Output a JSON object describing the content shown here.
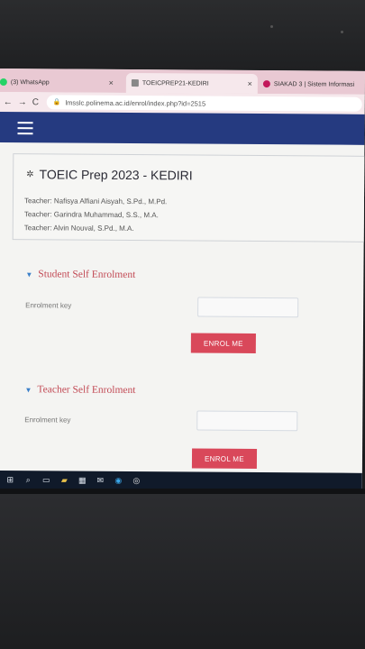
{
  "browser": {
    "tabs": [
      {
        "label": "(3) WhatsApp",
        "close": "×",
        "icon": "whatsapp-icon",
        "color": "#25d366"
      },
      {
        "label": "TOEICPREP21-KEDIRI",
        "close": "×",
        "icon": "moodle-icon",
        "color": "#888888"
      },
      {
        "label": "SIAKAD 3 | Sistem Informasi",
        "close": "",
        "icon": "siakad-icon",
        "color": "#c2185b"
      }
    ],
    "nav_glyphs": "←→C",
    "url": "lmsslc.polinema.ac.id/enrol/index.php?id=2515"
  },
  "navbar": {
    "menu_icon": "hamburger-icon",
    "color": "#253a80"
  },
  "course": {
    "title": "TOEIC Prep 2023 - KEDIRI",
    "teachers": [
      "Teacher: Nafisya Alfiani Aisyah, S.Pd., M.Pd.",
      "Teacher: Garindra Muhammad, S.S., M.A.",
      "Teacher: Alvin Nouval, S.Pd., M.A."
    ]
  },
  "sections": [
    {
      "title": "Student Self Enrolment",
      "field_label": "Enrolment key",
      "button": "ENROL ME"
    },
    {
      "title": "Teacher Self Enrolment",
      "field_label": "Enrolment key",
      "button": "ENROL ME"
    }
  ],
  "taskbar": {
    "icons": [
      "windows-icon",
      "search-icon",
      "task-view-icon",
      "file-explorer-icon",
      "store-icon",
      "mail-icon",
      "edge-icon",
      "chrome-icon"
    ]
  },
  "colors": {
    "accent": "#d9485a",
    "heading": "#c24a55"
  }
}
